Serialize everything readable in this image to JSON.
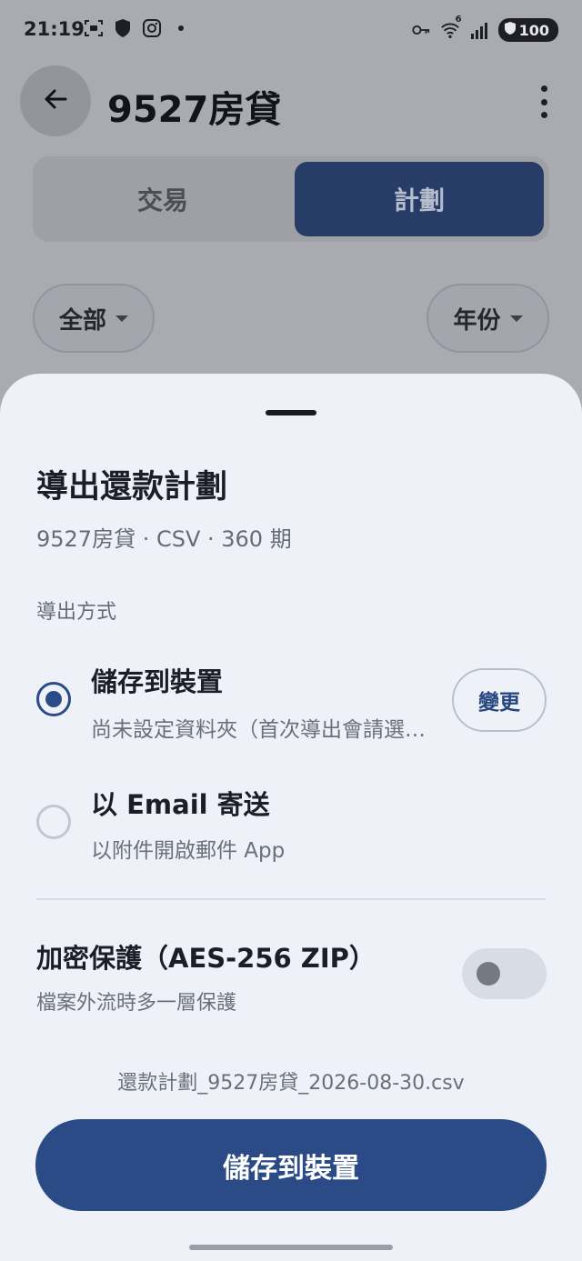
{
  "status_bar": {
    "time": "21:19",
    "network": "6",
    "battery": "100"
  },
  "app_bar": {
    "title": "9527房貸"
  },
  "tabs": [
    {
      "label": "交易",
      "selected": false
    },
    {
      "label": "計劃",
      "selected": true
    }
  ],
  "filters": {
    "scope": "全部",
    "year": "年份"
  },
  "sheet": {
    "title": "導出還款計劃",
    "subtitle": "9527房貸 · CSV · 360 期",
    "method_label": "導出方式",
    "options": [
      {
        "title": "儲存到裝置",
        "desc": "尚未設定資料夾（首次導出會請選擇資料夾）",
        "selected": true
      },
      {
        "title": "以 Email 寄送",
        "desc": "以附件開啟郵件 App",
        "selected": false
      }
    ],
    "change_label": "變更",
    "encryption": {
      "title": "加密保護（AES-256 ZIP）",
      "desc": "檔案外流時多一層保護",
      "enabled": false
    },
    "filename": "還款計劃_9527房貸_2026-08-30.csv",
    "primary_action": "儲存到裝置"
  },
  "colors": {
    "accent": "#2b4b86",
    "sheet_bg": "#eef2f8",
    "scrim": "#a9abb0"
  }
}
